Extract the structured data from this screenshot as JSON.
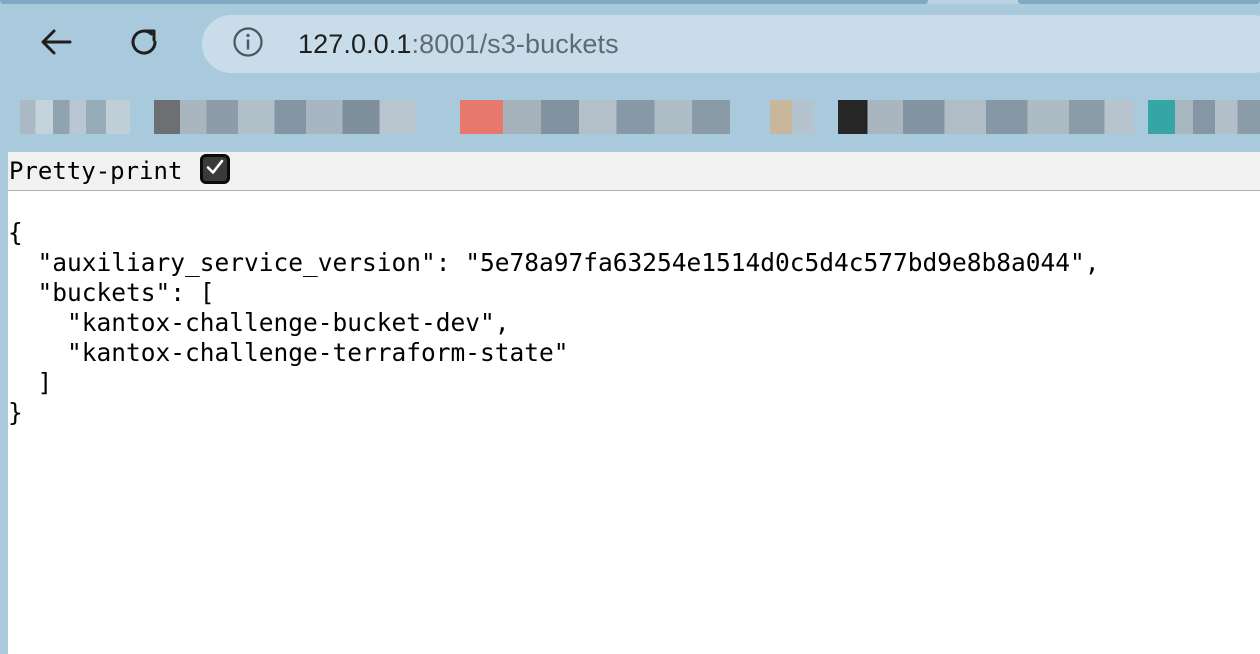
{
  "browser": {
    "url_host": "127.0.0.1",
    "url_rest": ":8001/s3-buckets",
    "icons": {
      "back": "arrow-left-icon",
      "reload": "reload-icon",
      "site_info": "info-icon"
    }
  },
  "page": {
    "pretty_print_label": "Pretty-print",
    "pretty_print_checked": true,
    "json_lines": [
      "{",
      "  \"auxiliary_service_version\": \"5e78a97fa63254e1514d0c5d4c577bd9e8b8a044\",",
      "  \"buckets\": [",
      "    \"kantox-challenge-bucket-dev\",",
      "    \"kantox-challenge-terraform-state\"",
      "  ]",
      "}"
    ]
  },
  "colors": {
    "toolbar_bg": "#a9c9dd",
    "omnibox_bg": "#c8dde9",
    "page_bg": "#ffffff",
    "pretty_print_bar_bg": "#f1f1f1"
  }
}
